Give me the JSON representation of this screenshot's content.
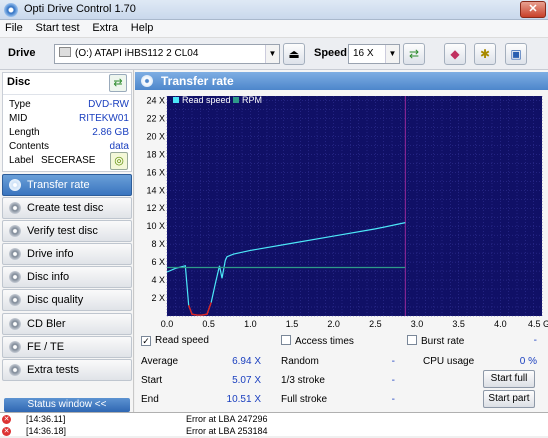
{
  "window": {
    "title": "Opti Drive Control 1.70",
    "close_glyph": "✕"
  },
  "menu": [
    "File",
    "Start test",
    "Extra",
    "Help"
  ],
  "toolbar": {
    "drive_label": "Drive",
    "drive_value": "(O:)   ATAPI iHBS112   2 CL04",
    "speed_label": "Speed",
    "speed_value": "16 X"
  },
  "disc": {
    "title": "Disc",
    "rows": [
      {
        "k": "Type",
        "v": "DVD-RW"
      },
      {
        "k": "MID",
        "v": "RITEKW01"
      },
      {
        "k": "Length",
        "v": "2.86 GB"
      },
      {
        "k": "Contents",
        "v": "data"
      },
      {
        "k": "Label",
        "v": "SECERASE"
      }
    ]
  },
  "nav": [
    {
      "label": "Transfer rate",
      "selected": true
    },
    {
      "label": "Create test disc"
    },
    {
      "label": "Verify test disc"
    },
    {
      "label": "Drive info"
    },
    {
      "label": "Disc info"
    },
    {
      "label": "Disc quality"
    },
    {
      "label": "CD Bler"
    },
    {
      "label": "FE / TE"
    },
    {
      "label": "Extra tests"
    }
  ],
  "status_window": "Status window <<",
  "panel_title": "Transfer rate",
  "chart_data": {
    "type": "line",
    "legend": [
      "Read speed",
      "RPM"
    ],
    "legend_colors": [
      "#4de8f8",
      "#2e9a8a"
    ],
    "background": "#101066",
    "marker_color": "#9a2a9a",
    "x_ticks": [
      "0.0",
      "0.5",
      "1.0",
      "1.5",
      "2.0",
      "2.5",
      "3.0",
      "3.5",
      "4.0",
      "4.5 GB"
    ],
    "y_ticks": [
      "2 X",
      "4 X",
      "6 X",
      "8 X",
      "10 X",
      "12 X",
      "14 X",
      "16 X",
      "18 X",
      "20 X",
      "22 X",
      "24 X"
    ],
    "xlim": [
      0,
      4.5
    ],
    "ylim": [
      0,
      24.5
    ],
    "disc_end_gb": 2.86,
    "series": [
      {
        "name": "Read speed",
        "x": [
          0.0,
          0.1,
          0.22,
          0.26,
          0.3,
          0.36,
          0.42,
          0.48,
          0.53,
          0.58,
          0.63,
          0.66,
          0.7,
          0.72,
          0.8,
          1.0,
          1.5,
          2.0,
          2.5,
          2.86
        ],
        "y": [
          4.9,
          5.3,
          5.6,
          1.2,
          0.2,
          0.1,
          0.1,
          0.2,
          1.5,
          3.6,
          5.6,
          4.2,
          6.2,
          6.6,
          6.9,
          7.3,
          8.1,
          8.9,
          9.7,
          10.4
        ]
      },
      {
        "name": "RPM",
        "x": [
          0.0,
          2.86
        ],
        "y": [
          5.4,
          5.4
        ]
      }
    ]
  },
  "stats": {
    "read_speed_label": "Read speed",
    "access_label": "Access times",
    "burst_label": "Burst rate",
    "average_label": "Average",
    "average": "6.94 X",
    "start_label": "Start",
    "start": "5.07 X",
    "end_label": "End",
    "end": "10.51 X",
    "random_label": "Random",
    "random": "-",
    "stroke13_label": "1/3 stroke",
    "stroke13": "-",
    "full_label": "Full stroke",
    "full": "-",
    "burst_value": "-",
    "cpu_label": "CPU usage",
    "cpu": "0 %",
    "start_full": "Start full",
    "start_part": "Start part"
  },
  "log": [
    {
      "time": "[14:36.11]",
      "msg": "Error at LBA 247296"
    },
    {
      "time": "[14:36.18]",
      "msg": "Error at LBA 253184"
    }
  ]
}
